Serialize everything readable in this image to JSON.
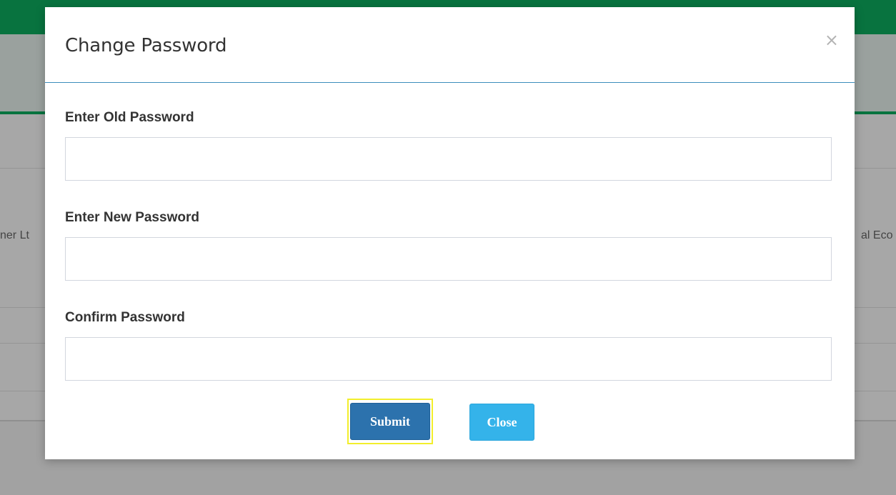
{
  "background": {
    "left_text": "ner Lt",
    "right_text": "al Eco"
  },
  "modal": {
    "title": "Change Password",
    "close_icon": "×",
    "fields": [
      {
        "label": "Enter Old Password",
        "value": "",
        "placeholder": ""
      },
      {
        "label": "Enter New Password",
        "value": "",
        "placeholder": ""
      },
      {
        "label": "Confirm Password",
        "value": "",
        "placeholder": ""
      }
    ],
    "buttons": {
      "submit_label": "Submit",
      "close_label": "Close"
    }
  },
  "colors": {
    "brand_green": "#08733f",
    "header_border": "#3c8dbc",
    "submit_bg": "#2c72ad",
    "close_bg": "#34b3ea",
    "focus_highlight": "#f2ee2c"
  }
}
